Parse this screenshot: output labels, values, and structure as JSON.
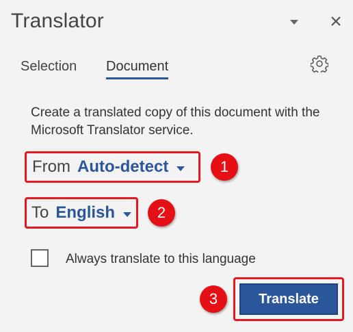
{
  "pane": {
    "title": "Translator",
    "menu_icon": "chevron-down-icon",
    "close_icon": "close-icon"
  },
  "tabs": [
    {
      "label": "Selection",
      "active": false
    },
    {
      "label": "Document",
      "active": true
    }
  ],
  "settings_icon": "gear-icon",
  "description": "Create a translated copy of this document with the Microsoft Translator service.",
  "from": {
    "label": "From",
    "value": "Auto-detect"
  },
  "to": {
    "label": "To",
    "value": "English"
  },
  "always_translate": {
    "label": "Always translate to this language",
    "checked": false
  },
  "translate_button": {
    "label": "Translate"
  },
  "callouts": [
    "1",
    "2",
    "3"
  ],
  "colors": {
    "accent": "#2b579a",
    "callout": "#e41015",
    "highlight_border": "#e4181d",
    "background": "#f3f3f3"
  }
}
